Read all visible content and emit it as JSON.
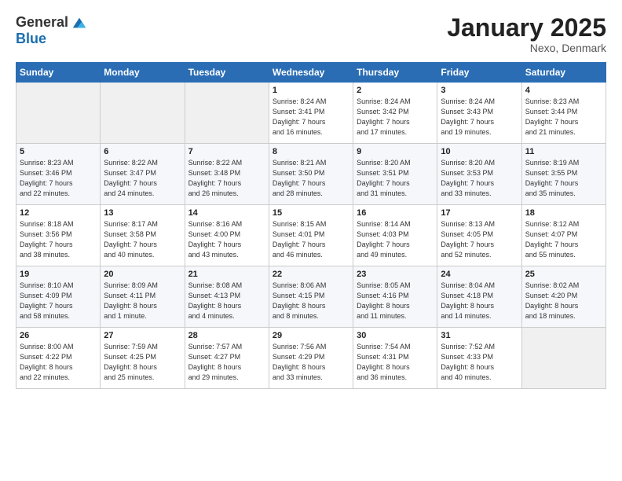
{
  "header": {
    "logo_general": "General",
    "logo_blue": "Blue",
    "title": "January 2025",
    "subtitle": "Nexo, Denmark"
  },
  "days_of_week": [
    "Sunday",
    "Monday",
    "Tuesday",
    "Wednesday",
    "Thursday",
    "Friday",
    "Saturday"
  ],
  "weeks": [
    [
      {
        "day": "",
        "sunrise": "",
        "sunset": "",
        "daylight": ""
      },
      {
        "day": "",
        "sunrise": "",
        "sunset": "",
        "daylight": ""
      },
      {
        "day": "",
        "sunrise": "",
        "sunset": "",
        "daylight": ""
      },
      {
        "day": "1",
        "sunrise": "Sunrise: 8:24 AM",
        "sunset": "Sunset: 3:41 PM",
        "daylight": "Daylight: 7 hours and 16 minutes."
      },
      {
        "day": "2",
        "sunrise": "Sunrise: 8:24 AM",
        "sunset": "Sunset: 3:42 PM",
        "daylight": "Daylight: 7 hours and 17 minutes."
      },
      {
        "day": "3",
        "sunrise": "Sunrise: 8:24 AM",
        "sunset": "Sunset: 3:43 PM",
        "daylight": "Daylight: 7 hours and 19 minutes."
      },
      {
        "day": "4",
        "sunrise": "Sunrise: 8:23 AM",
        "sunset": "Sunset: 3:44 PM",
        "daylight": "Daylight: 7 hours and 21 minutes."
      }
    ],
    [
      {
        "day": "5",
        "sunrise": "Sunrise: 8:23 AM",
        "sunset": "Sunset: 3:46 PM",
        "daylight": "Daylight: 7 hours and 22 minutes."
      },
      {
        "day": "6",
        "sunrise": "Sunrise: 8:22 AM",
        "sunset": "Sunset: 3:47 PM",
        "daylight": "Daylight: 7 hours and 24 minutes."
      },
      {
        "day": "7",
        "sunrise": "Sunrise: 8:22 AM",
        "sunset": "Sunset: 3:48 PM",
        "daylight": "Daylight: 7 hours and 26 minutes."
      },
      {
        "day": "8",
        "sunrise": "Sunrise: 8:21 AM",
        "sunset": "Sunset: 3:50 PM",
        "daylight": "Daylight: 7 hours and 28 minutes."
      },
      {
        "day": "9",
        "sunrise": "Sunrise: 8:20 AM",
        "sunset": "Sunset: 3:51 PM",
        "daylight": "Daylight: 7 hours and 31 minutes."
      },
      {
        "day": "10",
        "sunrise": "Sunrise: 8:20 AM",
        "sunset": "Sunset: 3:53 PM",
        "daylight": "Daylight: 7 hours and 33 minutes."
      },
      {
        "day": "11",
        "sunrise": "Sunrise: 8:19 AM",
        "sunset": "Sunset: 3:55 PM",
        "daylight": "Daylight: 7 hours and 35 minutes."
      }
    ],
    [
      {
        "day": "12",
        "sunrise": "Sunrise: 8:18 AM",
        "sunset": "Sunset: 3:56 PM",
        "daylight": "Daylight: 7 hours and 38 minutes."
      },
      {
        "day": "13",
        "sunrise": "Sunrise: 8:17 AM",
        "sunset": "Sunset: 3:58 PM",
        "daylight": "Daylight: 7 hours and 40 minutes."
      },
      {
        "day": "14",
        "sunrise": "Sunrise: 8:16 AM",
        "sunset": "Sunset: 4:00 PM",
        "daylight": "Daylight: 7 hours and 43 minutes."
      },
      {
        "day": "15",
        "sunrise": "Sunrise: 8:15 AM",
        "sunset": "Sunset: 4:01 PM",
        "daylight": "Daylight: 7 hours and 46 minutes."
      },
      {
        "day": "16",
        "sunrise": "Sunrise: 8:14 AM",
        "sunset": "Sunset: 4:03 PM",
        "daylight": "Daylight: 7 hours and 49 minutes."
      },
      {
        "day": "17",
        "sunrise": "Sunrise: 8:13 AM",
        "sunset": "Sunset: 4:05 PM",
        "daylight": "Daylight: 7 hours and 52 minutes."
      },
      {
        "day": "18",
        "sunrise": "Sunrise: 8:12 AM",
        "sunset": "Sunset: 4:07 PM",
        "daylight": "Daylight: 7 hours and 55 minutes."
      }
    ],
    [
      {
        "day": "19",
        "sunrise": "Sunrise: 8:10 AM",
        "sunset": "Sunset: 4:09 PM",
        "daylight": "Daylight: 7 hours and 58 minutes."
      },
      {
        "day": "20",
        "sunrise": "Sunrise: 8:09 AM",
        "sunset": "Sunset: 4:11 PM",
        "daylight": "Daylight: 8 hours and 1 minute."
      },
      {
        "day": "21",
        "sunrise": "Sunrise: 8:08 AM",
        "sunset": "Sunset: 4:13 PM",
        "daylight": "Daylight: 8 hours and 4 minutes."
      },
      {
        "day": "22",
        "sunrise": "Sunrise: 8:06 AM",
        "sunset": "Sunset: 4:15 PM",
        "daylight": "Daylight: 8 hours and 8 minutes."
      },
      {
        "day": "23",
        "sunrise": "Sunrise: 8:05 AM",
        "sunset": "Sunset: 4:16 PM",
        "daylight": "Daylight: 8 hours and 11 minutes."
      },
      {
        "day": "24",
        "sunrise": "Sunrise: 8:04 AM",
        "sunset": "Sunset: 4:18 PM",
        "daylight": "Daylight: 8 hours and 14 minutes."
      },
      {
        "day": "25",
        "sunrise": "Sunrise: 8:02 AM",
        "sunset": "Sunset: 4:20 PM",
        "daylight": "Daylight: 8 hours and 18 minutes."
      }
    ],
    [
      {
        "day": "26",
        "sunrise": "Sunrise: 8:00 AM",
        "sunset": "Sunset: 4:22 PM",
        "daylight": "Daylight: 8 hours and 22 minutes."
      },
      {
        "day": "27",
        "sunrise": "Sunrise: 7:59 AM",
        "sunset": "Sunset: 4:25 PM",
        "daylight": "Daylight: 8 hours and 25 minutes."
      },
      {
        "day": "28",
        "sunrise": "Sunrise: 7:57 AM",
        "sunset": "Sunset: 4:27 PM",
        "daylight": "Daylight: 8 hours and 29 minutes."
      },
      {
        "day": "29",
        "sunrise": "Sunrise: 7:56 AM",
        "sunset": "Sunset: 4:29 PM",
        "daylight": "Daylight: 8 hours and 33 minutes."
      },
      {
        "day": "30",
        "sunrise": "Sunrise: 7:54 AM",
        "sunset": "Sunset: 4:31 PM",
        "daylight": "Daylight: 8 hours and 36 minutes."
      },
      {
        "day": "31",
        "sunrise": "Sunrise: 7:52 AM",
        "sunset": "Sunset: 4:33 PM",
        "daylight": "Daylight: 8 hours and 40 minutes."
      },
      {
        "day": "",
        "sunrise": "",
        "sunset": "",
        "daylight": ""
      }
    ]
  ]
}
